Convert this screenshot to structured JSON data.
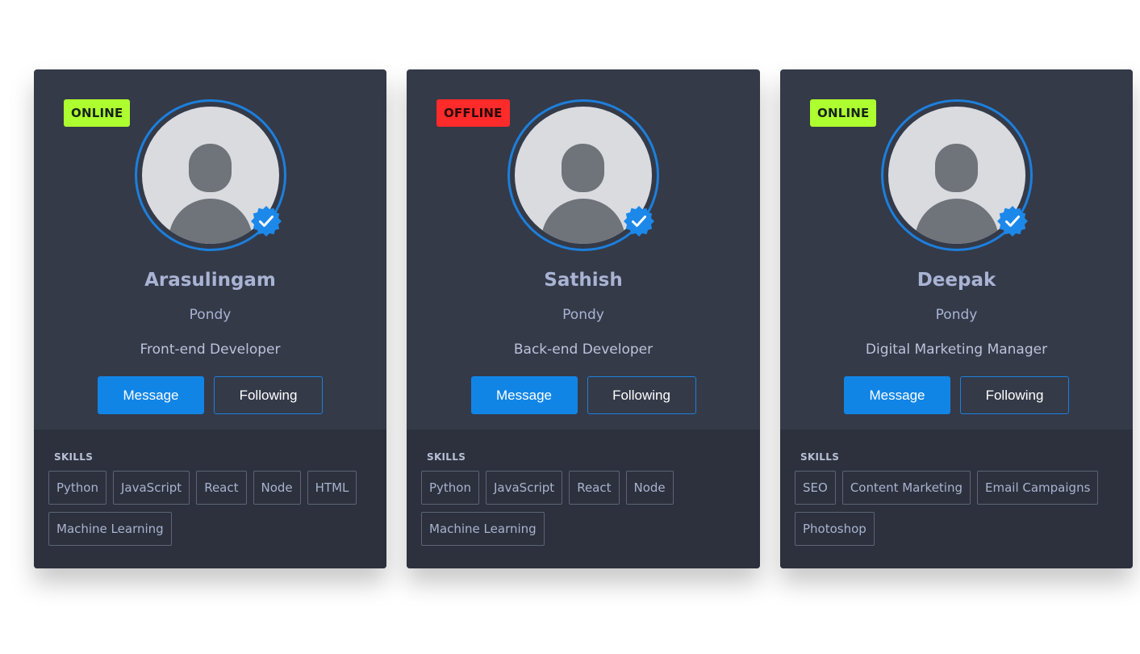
{
  "labels": {
    "message": "Message",
    "following": "Following",
    "skills_title": "SKILLS"
  },
  "colors": {
    "card_bg": "#343a48",
    "skills_bg": "#2c313d",
    "online": "#adff2f",
    "offline": "#ff2a2a",
    "accent": "#1185e6"
  },
  "cards": [
    {
      "status": "ONLINE",
      "name": "Arasulingam",
      "city": "Pondy",
      "role": "Front-end Developer",
      "skills": [
        "Python",
        "JavaScript",
        "React",
        "Node",
        "HTML",
        "Machine Learning"
      ]
    },
    {
      "status": "OFFLINE",
      "name": "Sathish",
      "city": "Pondy",
      "role": "Back-end Developer",
      "skills": [
        "Python",
        "JavaScript",
        "React",
        "Node",
        "Machine Learning"
      ]
    },
    {
      "status": "ONLINE",
      "name": "Deepak",
      "city": "Pondy",
      "role": "Digital Marketing Manager",
      "skills": [
        "SEO",
        "Content Marketing",
        "Email Campaigns",
        "Photoshop"
      ]
    }
  ]
}
